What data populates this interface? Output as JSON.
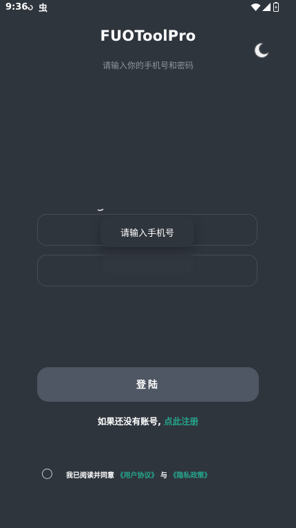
{
  "status_bar": {
    "time": "9:36",
    "icons": [
      "sync-icon",
      "bug-icon",
      "wifi-icon",
      "cell-signal-icon",
      "battery-icon"
    ]
  },
  "header": {
    "title": "FUOToolPro",
    "subtitle": "请输入你的手机号和密码"
  },
  "theme_toggle": {
    "icon": "moon-icon"
  },
  "form": {
    "phone_tooltip": "请输入手机号",
    "phone_value": "",
    "password_value": "",
    "login_label": "登陆"
  },
  "register": {
    "prompt": "如果还没有账号,",
    "link": "点此注册"
  },
  "agreement": {
    "checked": false,
    "text_prefix": "我已阅读并同意",
    "user_agreement": "《用户协议》",
    "conjunction": "与",
    "privacy_policy": "《隐私政策》"
  },
  "colors": {
    "background": "#2f353d",
    "accent": "#25a58c",
    "button": "#4e5763"
  }
}
